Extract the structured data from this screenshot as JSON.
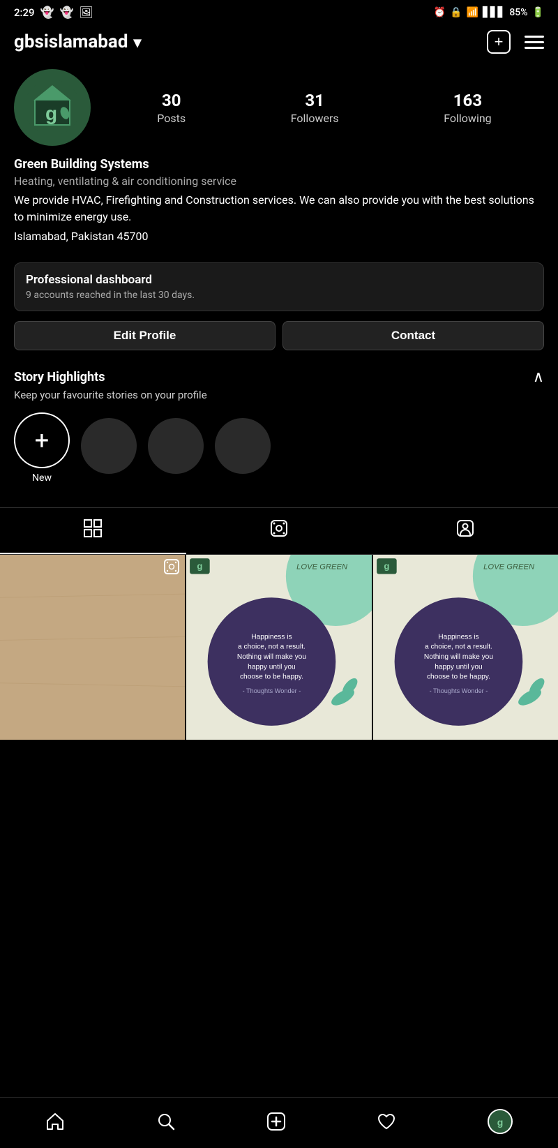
{
  "statusBar": {
    "time": "2:29",
    "battery": "85%"
  },
  "header": {
    "username": "gbsislamabad",
    "plusLabel": "+",
    "dropdownArrow": "▾"
  },
  "profile": {
    "name": "Green Building Systems",
    "category": "Heating, ventilating & air conditioning service",
    "bio": "We provide HVAC, Firefighting and Construction services. We can also provide you with the best solutions to minimize energy use.",
    "location": "Islamabad, Pakistan 45700",
    "stats": {
      "posts": {
        "count": "30",
        "label": "Posts"
      },
      "followers": {
        "count": "31",
        "label": "Followers"
      },
      "following": {
        "count": "163",
        "label": "Following"
      }
    }
  },
  "proDashboard": {
    "title": "Professional dashboard",
    "subtitle": "9 accounts reached in the last 30 days."
  },
  "actions": {
    "editProfile": "Edit Profile",
    "contact": "Contact"
  },
  "highlights": {
    "title": "Story Highlights",
    "subtitle": "Keep your favourite stories on your profile",
    "newLabel": "New"
  },
  "tabs": {
    "grid": "⊞",
    "reels": "▶",
    "tagged": "👤"
  },
  "bottomNav": {
    "home": "home",
    "search": "search",
    "add": "add",
    "likes": "likes",
    "profile": "profile"
  }
}
